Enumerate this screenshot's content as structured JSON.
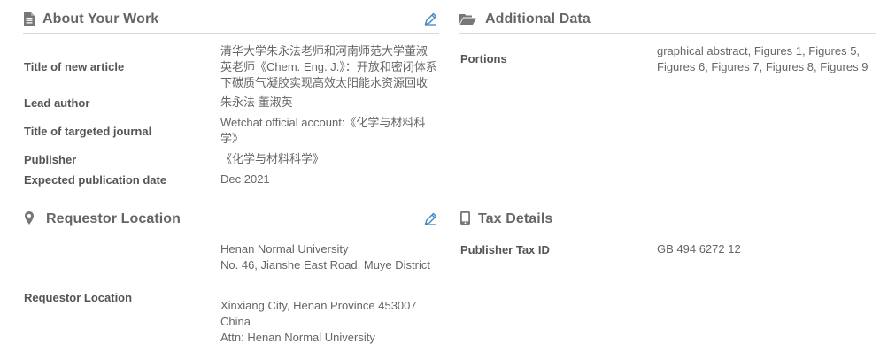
{
  "about": {
    "title": "About Your Work",
    "rows": [
      {
        "label": "Title of new article",
        "value_lines": [
          "清华大学朱永法老师和河南师范大学董淑",
          "英老师《Chem. Eng. J.》：开放和密闭体系",
          "下碳质气凝胶实现高效太阳能水资源回收"
        ]
      },
      {
        "label": "Lead author",
        "value_lines": [
          "朱永法 董淑英"
        ]
      },
      {
        "label": "Title of targeted journal",
        "value_lines": [
          "Wetchat official account:《化学与材料科",
          "学》"
        ]
      },
      {
        "label": "Publisher",
        "value_lines": [
          "《化学与材料科学》"
        ]
      },
      {
        "label": "Expected publication date",
        "value_lines": [
          "Dec 2021"
        ]
      }
    ]
  },
  "additional": {
    "title": "Additional Data",
    "rows": [
      {
        "label": "Portions",
        "value_lines": [
          "graphical abstract, Figures 1, Figures 5,",
          "Figures 6, Figures 7, Figures 8, Figures 9"
        ]
      }
    ]
  },
  "requestor": {
    "title": "Requestor Location",
    "label": "Requestor Location",
    "address_lines": [
      "Henan Normal University",
      "No. 46, Jianshe East Road, Muye District",
      "Xinxiang City, Henan Province 453007",
      "China",
      "Attn: Henan Normal University"
    ]
  },
  "tax": {
    "title": "Tax Details",
    "rows": [
      {
        "label": "Publisher Tax ID",
        "value_lines": [
          "GB 494 6272 12"
        ]
      }
    ]
  },
  "colors": {
    "icon": "#777777",
    "edit_icon": "#3d86c6",
    "rule": "#d9d9d9"
  },
  "icons": {
    "about": "document-icon",
    "additional": "folder-open-icon",
    "requestor": "map-marker-icon",
    "tax": "tablet-icon",
    "edit": "pencil-icon"
  }
}
